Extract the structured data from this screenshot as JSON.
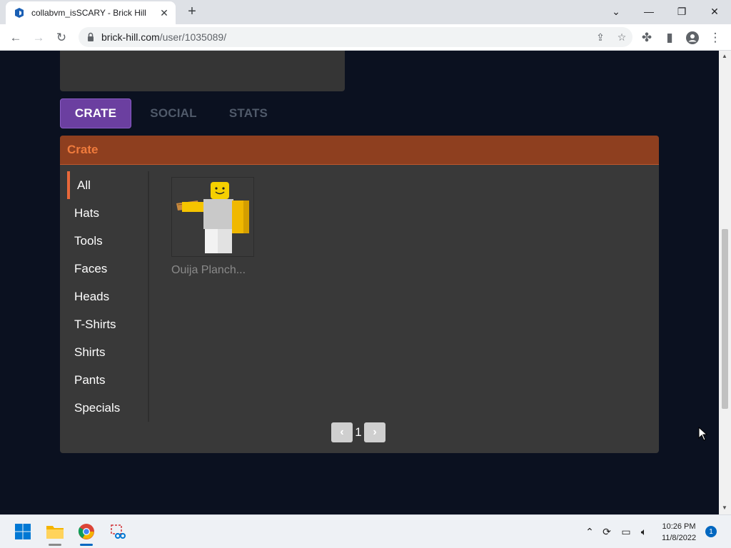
{
  "browser": {
    "tab_title": "collabvm_isSCARY - Brick Hill",
    "url_host": "brick-hill.com",
    "url_path": "/user/1035089/",
    "new_tab": "+"
  },
  "profile": {
    "tabs": [
      "CRATE",
      "SOCIAL",
      "STATS"
    ]
  },
  "crate": {
    "title": "Crate",
    "categories": [
      "All",
      "Hats",
      "Tools",
      "Faces",
      "Heads",
      "T-Shirts",
      "Shirts",
      "Pants",
      "Specials"
    ],
    "active_category": "All",
    "items": [
      {
        "name": "Ouija Planch..."
      }
    ],
    "page": "1"
  },
  "taskbar": {
    "time": "10:26 PM",
    "date": "11/8/2022",
    "notifications": "1"
  },
  "colors": {
    "page_bg": "#0b1120",
    "panel_bg": "#393939",
    "crate_header": "#8e3f1f",
    "crate_title": "#f07b3c",
    "active_tab": "#6b3fa0",
    "active_accent": "#e8683a"
  }
}
